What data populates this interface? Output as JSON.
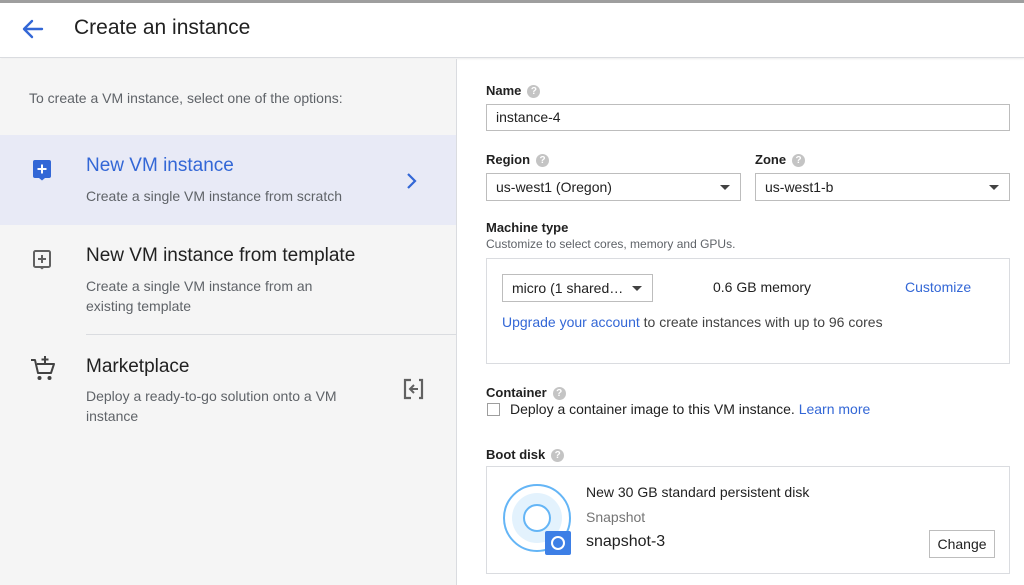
{
  "header": {
    "title": "Create an instance"
  },
  "left": {
    "intro": "To create a VM instance, select one of the options:",
    "options": [
      {
        "title": "New VM instance",
        "desc": "Create a single VM instance from scratch",
        "icon": "add-box-icon",
        "selected": true
      },
      {
        "title": "New VM instance from template",
        "desc": "Create a single VM instance from an existing template",
        "icon": "add-box-outline-icon",
        "selected": false
      },
      {
        "title": "Marketplace",
        "desc": "Deploy a ready-to-go solution onto a VM instance",
        "icon": "cart-icon",
        "selected": false
      }
    ]
  },
  "form": {
    "name": {
      "label": "Name",
      "value": "instance-4"
    },
    "region": {
      "label": "Region",
      "value": "us-west1 (Oregon)"
    },
    "zone": {
      "label": "Zone",
      "value": "us-west1-b"
    },
    "machine_type": {
      "label": "Machine type",
      "hint": "Customize to select cores, memory and GPUs.",
      "value": "micro (1 shared…",
      "memory": "0.6 GB memory",
      "customize": "Customize",
      "upgrade_link": "Upgrade your account",
      "upgrade_text": " to create instances with up to 96 cores"
    },
    "container": {
      "label": "Container",
      "checkbox_text": "Deploy a container image to this VM instance.",
      "learn_more": "Learn more",
      "checked": false
    },
    "boot_disk": {
      "label": "Boot disk",
      "title": "New 30 GB standard persistent disk",
      "type": "Snapshot",
      "name": "snapshot-3",
      "change": "Change"
    }
  },
  "colors": {
    "accent": "#3367d6",
    "selected_bg": "#e8eaf6",
    "left_bg": "#f5f5f5"
  }
}
